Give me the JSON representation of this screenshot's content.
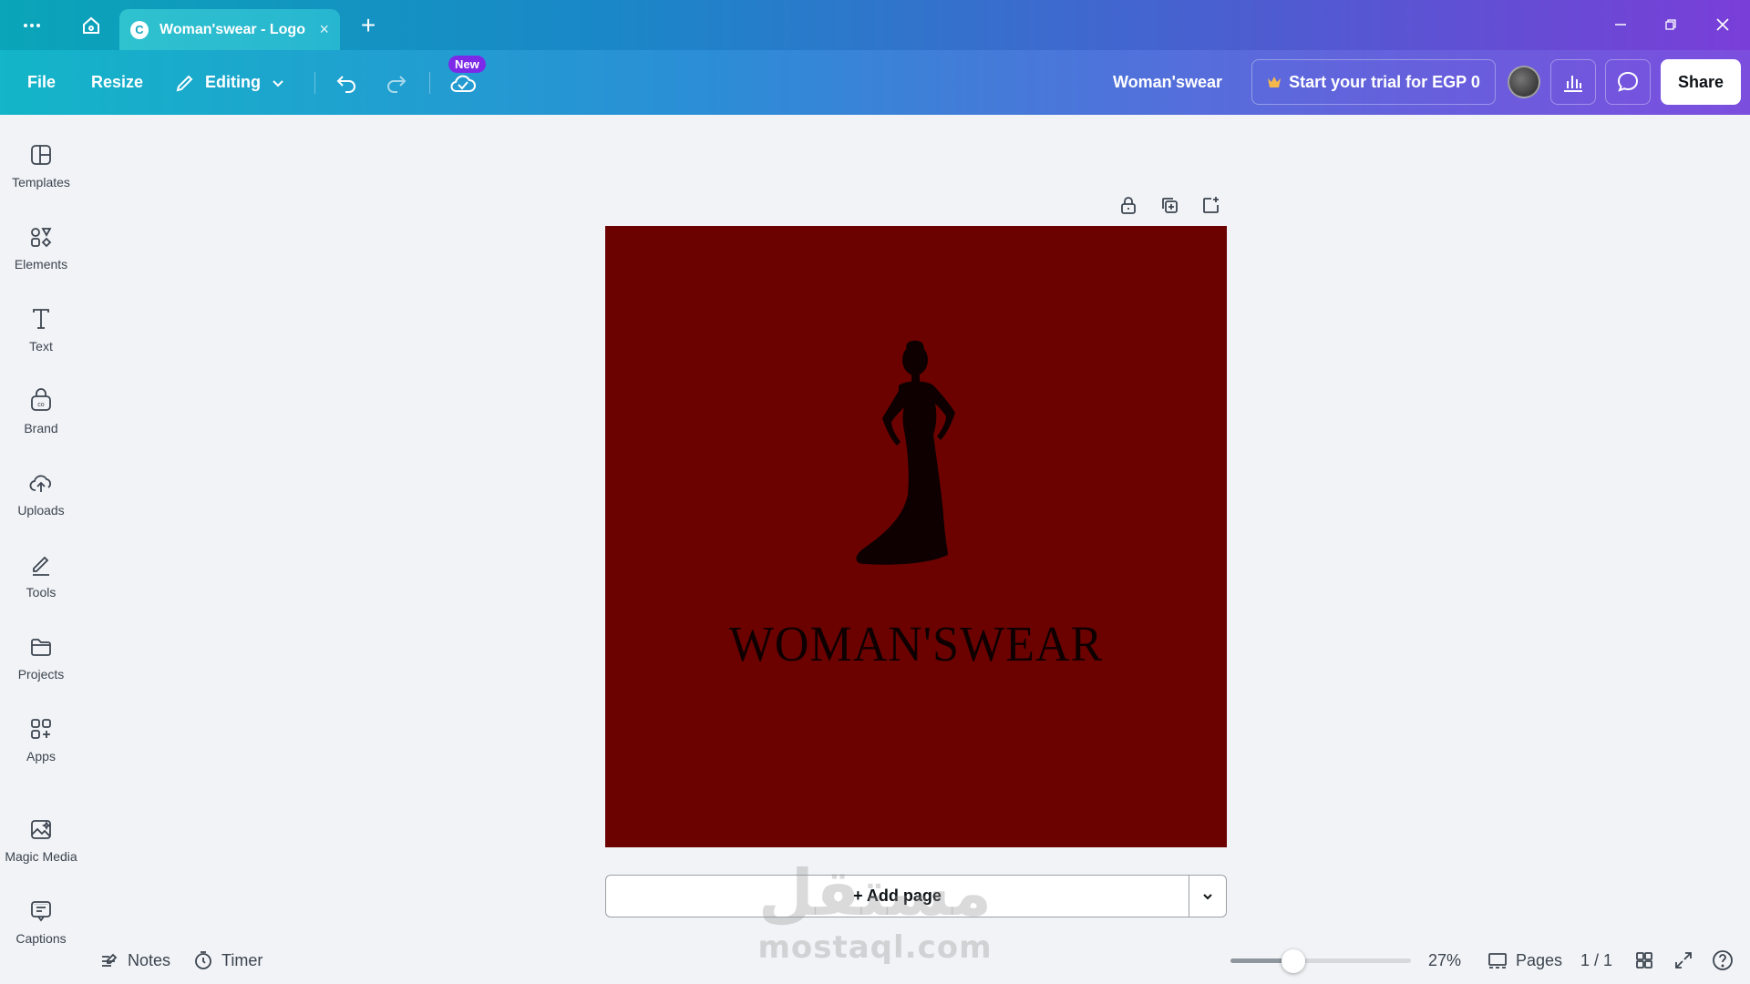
{
  "titlebar": {
    "tab_title": "Woman'swear - Logo",
    "tab_logo_letter": "C",
    "tab_close": "×",
    "new_tab": "+"
  },
  "menubar": {
    "file": "File",
    "resize": "Resize",
    "editing": "Editing",
    "new_badge": "New",
    "design_title": "Woman'swear",
    "trial_label": "Start your trial for EGP 0",
    "share": "Share"
  },
  "sidebar": {
    "items": [
      {
        "label": "Templates",
        "icon": "templates-icon"
      },
      {
        "label": "Elements",
        "icon": "elements-icon"
      },
      {
        "label": "Text",
        "icon": "text-icon"
      },
      {
        "label": "Brand",
        "icon": "brand-icon"
      },
      {
        "label": "Uploads",
        "icon": "uploads-icon"
      },
      {
        "label": "Tools",
        "icon": "tools-icon"
      },
      {
        "label": "Projects",
        "icon": "projects-icon"
      },
      {
        "label": "Apps",
        "icon": "apps-icon"
      },
      {
        "label": "Magic Media",
        "icon": "magic-media-icon"
      },
      {
        "label": "Captions",
        "icon": "captions-icon"
      }
    ]
  },
  "design": {
    "brand_text": "WOMAN'SWEAR",
    "background_color": "#6b0200"
  },
  "canvas": {
    "add_page": "+ Add page"
  },
  "watermark": {
    "arabic": "مستقل",
    "latin": "mostaql.com"
  },
  "footer": {
    "notes": "Notes",
    "timer": "Timer",
    "zoom": "27%",
    "zoom_fraction": 0.27,
    "pages_label": "Pages",
    "page_count": "1 / 1"
  },
  "colors": {
    "accent": "#7d2ae8",
    "gradient_start": "#13b5c8",
    "gradient_end": "#7c4ede"
  }
}
